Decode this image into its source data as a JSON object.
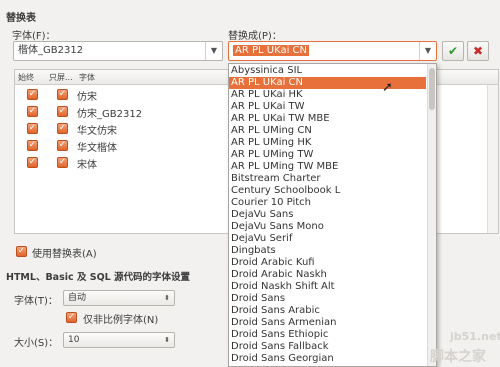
{
  "section_title": "替换表",
  "font_label": "字体(F)：",
  "replace_label": "替换成(P)：",
  "font_value": "楷体_GB2312",
  "replace_value": "AR PL UKai CN",
  "table": {
    "headers": [
      "始终",
      "只屏...",
      "字体"
    ],
    "rows": [
      {
        "font": "仿宋"
      },
      {
        "font": "仿宋_GB2312"
      },
      {
        "font": "华文仿宋"
      },
      {
        "font": "华文楷体"
      },
      {
        "font": "宋体"
      }
    ]
  },
  "use_table_label": "使用替换表(A)",
  "html_section": "HTML、Basic 及 SQL 源代码的字体设置",
  "html_font_label": "字体(T)：",
  "html_font_value": "自动",
  "nonprop_label": "仅非比例字体(N)",
  "size_label": "大小(S)：",
  "size_value": "10",
  "dropdown_items": [
    "Abyssinica SIL",
    "AR PL UKai CN",
    "AR PL UKai HK",
    "AR PL UKai TW",
    "AR PL UKai TW MBE",
    "AR PL UMing CN",
    "AR PL UMing HK",
    "AR PL UMing TW",
    "AR PL UMing TW MBE",
    "Bitstream Charter",
    "Century Schoolbook L",
    "Courier 10 Pitch",
    "DejaVu Sans",
    "DejaVu Sans Mono",
    "DejaVu Serif",
    "Dingbats",
    "Droid Arabic Kufi",
    "Droid Arabic Naskh",
    "Droid Naskh Shift Alt",
    "Droid Sans",
    "Droid Sans Arabic",
    "Droid Sans Armenian",
    "Droid Sans Ethiopic",
    "Droid Sans Fallback",
    "Droid Sans Georgian"
  ],
  "selected_index": 1,
  "watermark_1": "jb51.net",
  "watermark_2": "脚本之家",
  "colors": {
    "accent": "#e8703a",
    "apply_check": "#2e9a2e",
    "delete_x": "#c52b2b"
  }
}
